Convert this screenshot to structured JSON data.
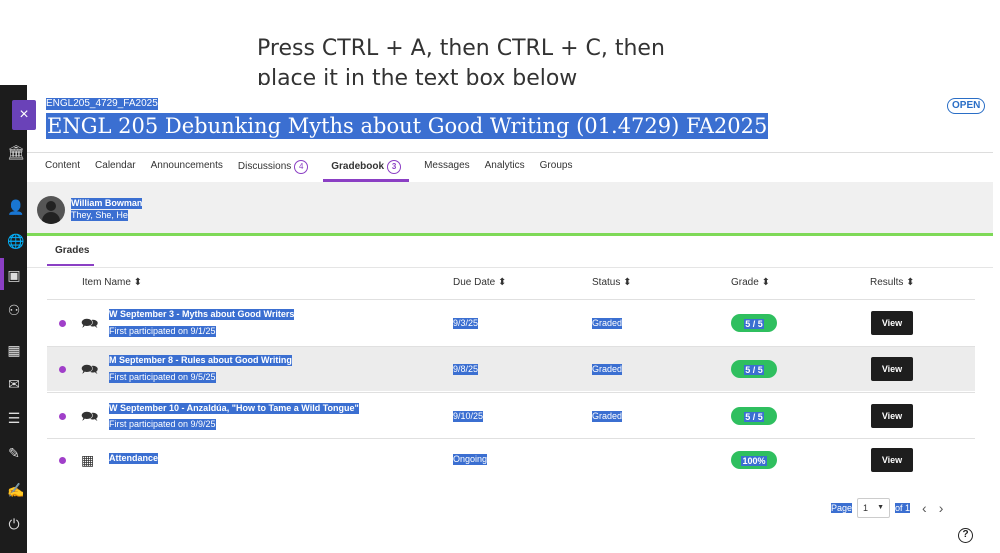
{
  "instruction": {
    "line1": "Press CTRL + A, then CTRL + C, then",
    "line2": "place it in the text box below"
  },
  "course": {
    "code": "ENGL205_4729_FA2025",
    "title": "ENGL 205 Debunking Myths about Good Writing (01.4729) FA2025",
    "badge": "OPEN",
    "close_label": "×"
  },
  "tabs": [
    {
      "label": "Content"
    },
    {
      "label": "Calendar"
    },
    {
      "label": "Announcements"
    },
    {
      "label": "Discussions",
      "count": "4"
    },
    {
      "label": "Gradebook",
      "count": "3"
    },
    {
      "label": "Messages"
    },
    {
      "label": "Analytics"
    },
    {
      "label": "Groups"
    }
  ],
  "user": {
    "name": "William Bowman",
    "pronouns": "They, She, He"
  },
  "subtab": "Grades",
  "columns": {
    "item": "Item Name ⬍",
    "due": "Due Date ⬍",
    "status": "Status ⬍",
    "grade": "Grade ⬍",
    "results": "Results ⬍"
  },
  "rows": [
    {
      "title": "W September 3 - Myths about Good Writers",
      "sub": "First participated on 9/1/25",
      "due": "9/3/25",
      "status": "Graded",
      "grade": "5 / 5",
      "action": "View"
    },
    {
      "title": "M September 8 - Rules about Good Writing",
      "sub": "First participated on 9/5/25",
      "due": "9/8/25",
      "status": "Graded",
      "grade": "5 / 5",
      "action": "View"
    },
    {
      "title": "W September 10 - Anzaldúa, \"How to Tame a Wild Tongue\"",
      "sub": "First participated on 9/9/25",
      "due": "9/10/25",
      "status": "Graded",
      "grade": "5 / 5",
      "action": "View"
    },
    {
      "title": "Attendance",
      "sub": "",
      "due": "Ongoing",
      "status": "",
      "grade": "100%",
      "action": "View"
    }
  ],
  "pager": {
    "page_label": "Page",
    "page_value": "1",
    "of_label": "of 1"
  },
  "colors": {
    "accent": "#8b3fc4",
    "selection": "#3b6fd1",
    "grade_pill": "#2fbf5f",
    "green_line": "#7ed957"
  }
}
